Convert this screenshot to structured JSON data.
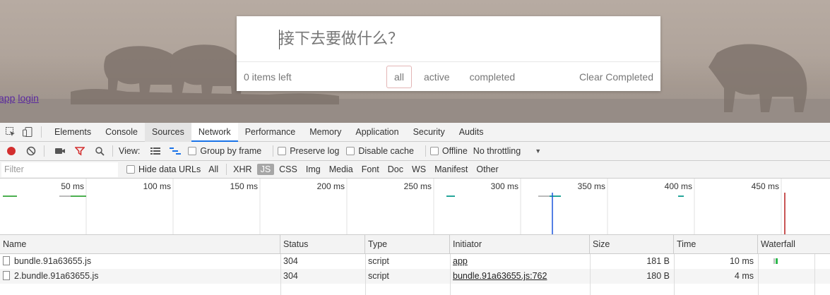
{
  "app": {
    "links": [
      "app",
      "login"
    ],
    "input_placeholder": "接下去要做什么？",
    "footer": {
      "items_left": "0 items left",
      "filters": [
        "all",
        "active",
        "completed"
      ],
      "selected_filter": "all",
      "clear": "Clear Completed"
    },
    "colors": {
      "selected_filter_border": "#e3b5b5",
      "link": "#5b2a9e"
    }
  },
  "devtools": {
    "tabs": [
      "Elements",
      "Console",
      "Sources",
      "Network",
      "Performance",
      "Memory",
      "Application",
      "Security",
      "Audits"
    ],
    "active_tab": "Network",
    "toolbar": {
      "view_label": "View:",
      "group_by_frame": "Group by frame",
      "preserve_log": "Preserve log",
      "disable_cache": "Disable cache",
      "offline": "Offline",
      "throttling": "No throttling",
      "record_color": "#d32f2f",
      "filter_icon_color": "#d32f2f"
    },
    "filterbar": {
      "placeholder": "Filter",
      "hide_data_urls": "Hide data URLs",
      "all": "All",
      "types": [
        "XHR",
        "JS",
        "CSS",
        "Img",
        "Media",
        "Font",
        "Doc",
        "WS",
        "Manifest",
        "Other"
      ],
      "selected_type": "JS"
    },
    "timeline_ticks": [
      "50 ms",
      "100 ms",
      "150 ms",
      "200 ms",
      "250 ms",
      "300 ms",
      "350 ms",
      "400 ms",
      "450 ms"
    ],
    "table": {
      "headers": [
        "Name",
        "Status",
        "Type",
        "Initiator",
        "Size",
        "Time",
        "Waterfall"
      ],
      "rows": [
        {
          "name": "bundle.91a63655.js",
          "status": "304",
          "type": "script",
          "initiator": "app",
          "size": "181 B",
          "time": "10 ms"
        },
        {
          "name": "2.bundle.91a63655.js",
          "status": "304",
          "type": "script",
          "initiator": "bundle.91a63655.js:762",
          "size": "180 B",
          "time": "4 ms"
        }
      ]
    }
  }
}
